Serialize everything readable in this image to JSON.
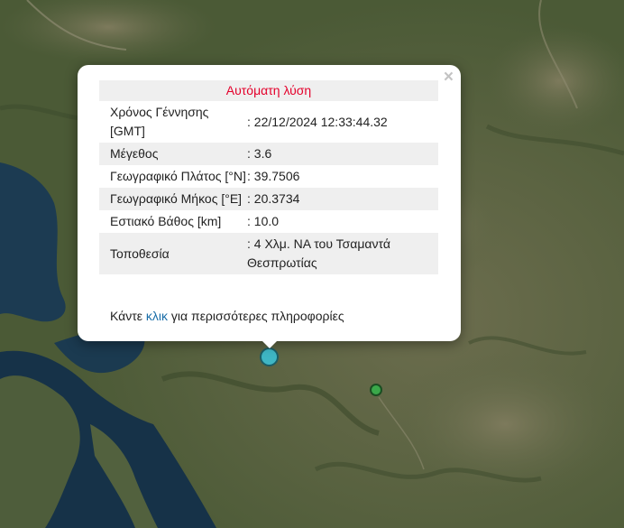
{
  "popup": {
    "close_icon": "×",
    "title": "Αυτόματη λύση",
    "rows": [
      {
        "label": "Χρόνος Γέννησης [GMT]",
        "value": ": 22/12/2024 12:33:44.32"
      },
      {
        "label": "Μέγεθος",
        "value": ": 3.6"
      },
      {
        "label": "Γεωγραφικό Πλάτος [°N]",
        "value": ": 39.7506"
      },
      {
        "label": "Γεωγραφικό Μήκος [°E]",
        "value": ": 20.3734"
      },
      {
        "label": "Εστιακό Βάθος [km]",
        "value": ": 10.0"
      },
      {
        "label": "Τοποθεσία",
        "value": ": 4 Χλμ. ΝΑ του Τσαμαντά Θεσπρωτίας"
      }
    ],
    "more_prefix": "Κάντε ",
    "more_link": "κλικ",
    "more_suffix": " για περισσότερες πληροφορίες"
  },
  "markers": {
    "main_color": "#3fb6c4",
    "secondary_color": "#3aa84a"
  },
  "colors": {
    "title_red": "#e4002b",
    "link_blue": "#1a6ea8",
    "sea": "#15324a",
    "land": "#4d5e3a"
  }
}
